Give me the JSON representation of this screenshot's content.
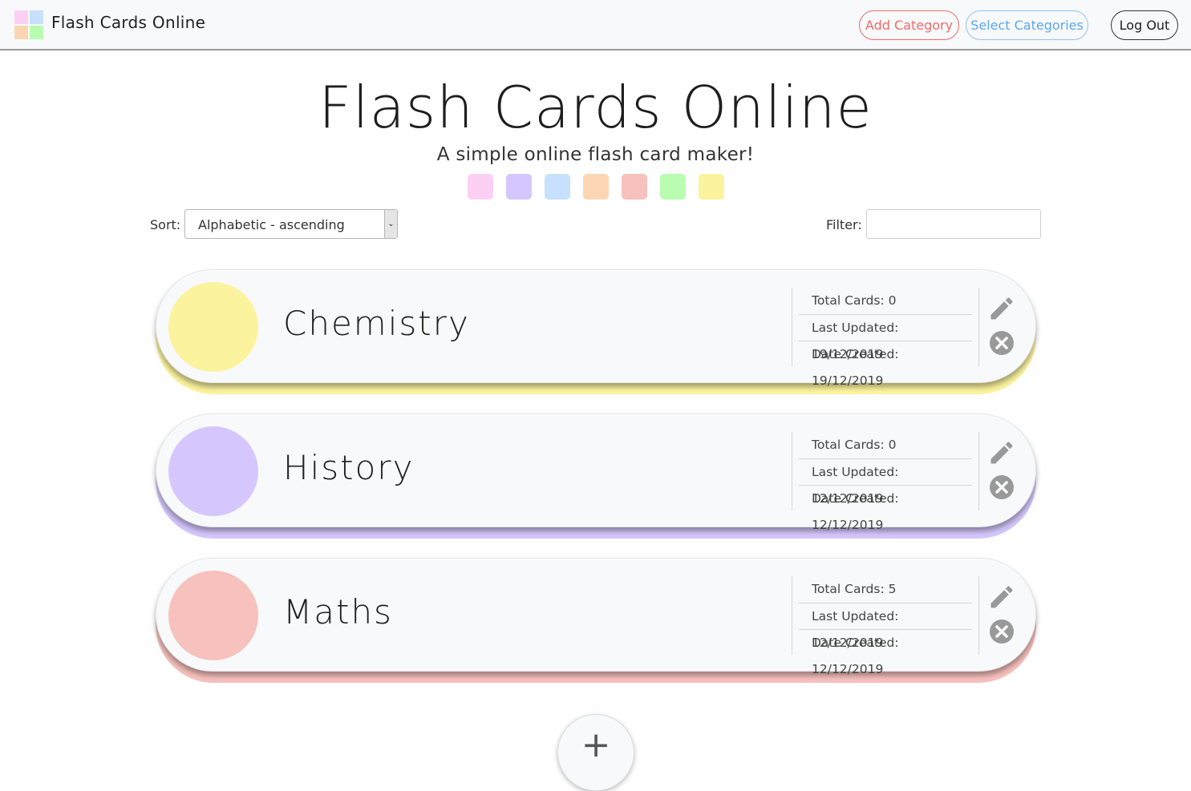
{
  "navbar": {
    "brand": "Flash Cards Online",
    "add_category": "Add Category",
    "select_categories": "Select Categories",
    "log_out": "Log Out",
    "logo_colors": [
      "#fdd0f3",
      "#c6e0fd",
      "#fcd6b2",
      "#b9fdb1"
    ]
  },
  "hero": {
    "title": "Flash Cards Online",
    "subtitle": "A simple online flash card maker!"
  },
  "swatches": [
    "#fdd0f3",
    "#d5c7fd",
    "#c6e0fd",
    "#fcd6b2",
    "#f7c1bd",
    "#b9fdb1",
    "#fcf39e"
  ],
  "controls": {
    "sort_label": "Sort:",
    "sort_value": "Alphabetic - ascending",
    "filter_label": "Filter:",
    "filter_value": ""
  },
  "categories": [
    {
      "name": "Chemistry",
      "color": "#fcf39e",
      "total": "Total Cards: 0",
      "updated": "Last Updated: 19/12/2019",
      "created": "Date Created: 19/12/2019"
    },
    {
      "name": "History",
      "color": "#d5c7fd",
      "total": "Total Cards: 0",
      "updated": "Last Updated: 12/12/2019",
      "created": "Date Created: 12/12/2019"
    },
    {
      "name": "Maths",
      "color": "#f7c1bd",
      "total": "Total Cards: 5",
      "updated": "Last Updated: 12/12/2019",
      "created": "Date Created: 12/12/2019"
    }
  ],
  "add_button": "+"
}
